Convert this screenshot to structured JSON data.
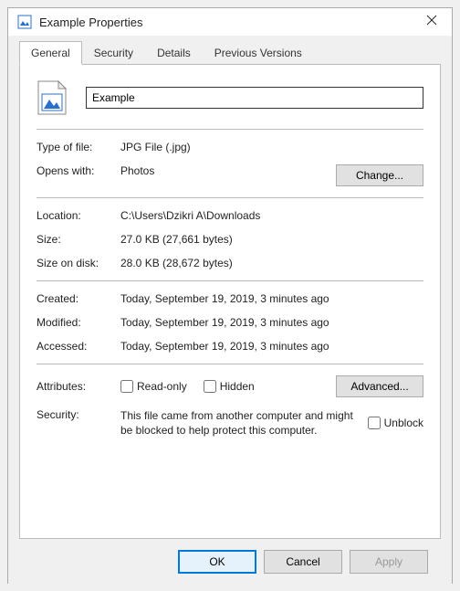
{
  "window": {
    "title": "Example Properties"
  },
  "tabs": {
    "general": "General",
    "security": "Security",
    "details": "Details",
    "previous": "Previous Versions"
  },
  "filename": "Example",
  "props": {
    "type_label": "Type of file:",
    "type_value": "JPG File (.jpg)",
    "opens_label": "Opens with:",
    "opens_value": "Photos",
    "change_btn": "Change...",
    "location_label": "Location:",
    "location_value": "C:\\Users\\Dzikri A\\Downloads",
    "size_label": "Size:",
    "size_value": "27.0 KB (27,661 bytes)",
    "disk_label": "Size on disk:",
    "disk_value": "28.0 KB (28,672 bytes)",
    "created_label": "Created:",
    "created_value": "Today, September 19, 2019, 3 minutes ago",
    "modified_label": "Modified:",
    "modified_value": "Today, September 19, 2019, 3 minutes ago",
    "accessed_label": "Accessed:",
    "accessed_value": "Today, September 19, 2019, 3 minutes ago",
    "attributes_label": "Attributes:",
    "readonly_label": "Read-only",
    "hidden_label": "Hidden",
    "advanced_btn": "Advanced...",
    "security_label": "Security:",
    "security_text": "This file came from another computer and might be blocked to help protect this computer.",
    "unblock_label": "Unblock"
  },
  "footer": {
    "ok": "OK",
    "cancel": "Cancel",
    "apply": "Apply"
  }
}
